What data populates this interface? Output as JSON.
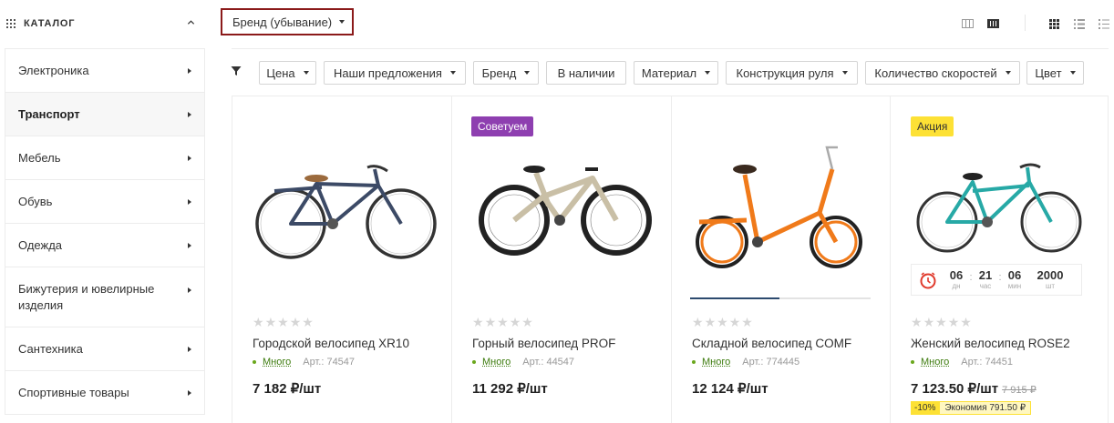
{
  "catalog": {
    "title": "КАТАЛОГ",
    "items": [
      {
        "label": "Электроника",
        "active": false
      },
      {
        "label": "Транспорт",
        "active": true
      },
      {
        "label": "Мебель",
        "active": false
      },
      {
        "label": "Обувь",
        "active": false
      },
      {
        "label": "Одежда",
        "active": false
      },
      {
        "label": "Бижутерия и ювелирные изделия",
        "active": false
      },
      {
        "label": "Сантехника",
        "active": false
      },
      {
        "label": "Спортивные товары",
        "active": false
      }
    ]
  },
  "sort": {
    "label": "Бренд (убывание)"
  },
  "filters": [
    "Цена",
    "Наши предложения",
    "Бренд",
    "В наличии",
    "Материал",
    "Конструкция руля",
    "Количество скоростей",
    "Цвет"
  ],
  "products": [
    {
      "name": "Городской велосипед XR10",
      "stock": "Много",
      "article": "Арт.: 74547",
      "price": "7 182 ₽/шт",
      "badge": "",
      "frame_color": "#3c4a66"
    },
    {
      "name": "Горный велосипед PROF",
      "stock": "Много",
      "article": "Арт.: 44547",
      "price": "11 292 ₽/шт",
      "badge": "Советуем",
      "frame_color": "#c9bfa6"
    },
    {
      "name": "Складной велосипед COMF",
      "stock": "Много",
      "article": "Арт.: 774445",
      "price": "12 124 ₽/шт",
      "badge": "",
      "frame_color": "#f07a1a"
    },
    {
      "name": "Женский велосипед ROSE2",
      "stock": "Много",
      "article": "Арт.: 74451",
      "price": "7 123.50 ₽/шт",
      "old_price": "7 915 ₽",
      "badge": "Акция",
      "discount_pct": "-10%",
      "discount_save": "Экономия 791.50 ₽",
      "frame_color": "#27a9a6",
      "timer": {
        "days": "06",
        "days_unit": "дн",
        "hours": "21",
        "hours_unit": "час",
        "minutes": "06",
        "minutes_unit": "мин",
        "qty": "2000",
        "qty_unit": "шт"
      }
    }
  ],
  "colors": {
    "accent_border": "#8b1a1a",
    "badge_purple": "#8e3fb0",
    "badge_yellow": "#fde135",
    "stock_green": "#6aa71d"
  }
}
